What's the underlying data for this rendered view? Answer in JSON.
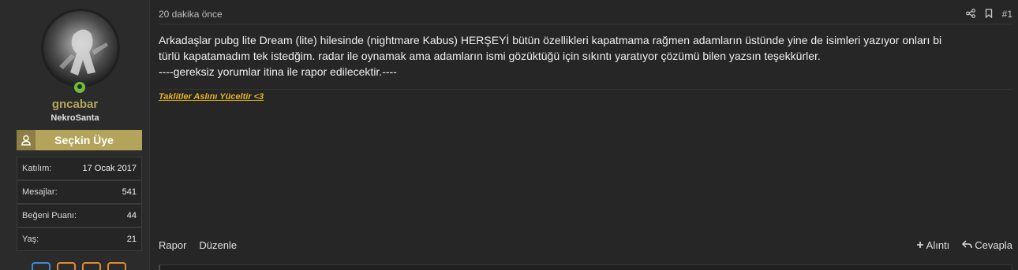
{
  "user": {
    "name": "gncabar",
    "title": "NekroSanta",
    "banner": "Seçkin Üye",
    "stats": [
      {
        "label": "Katılım:",
        "value": "17 Ocak 2017"
      },
      {
        "label": "Mesajlar:",
        "value": "541"
      },
      {
        "label": "Beğeni Puanı:",
        "value": "44"
      },
      {
        "label": "Yaş:",
        "value": "21"
      }
    ],
    "online_color": "#6cbf3c",
    "name_color": "#b5a55e"
  },
  "post": {
    "time": "20 dakika önce",
    "number": "#1",
    "body_line1": "Arkadaşlar pubg lite Dream (lite) hilesinde (nightmare Kabus) HERŞEYİ bütün özellikleri kapatmama rağmen adamların üstünde yine de isimleri yazıyor onları bi",
    "body_line2": "türlü kapatamadım tek istedğim. radar ile oynamak ama adamların ismi gözüktüğü için sıkıntı yaratıyor çözümü bilen yazsın teşekkürler.",
    "body_line3": "----gereksiz yorumlar itina ile rapor edilecektir.----",
    "signature": "Taklitler Aslını Yüceltir <3",
    "signature_color": "#e6b422"
  },
  "footer": {
    "report": "Rapor",
    "edit": "Düzenle",
    "quote": "Alıntı",
    "reply": "Cevapla"
  },
  "icons": [
    "user-icon",
    "share-icon",
    "bookmark-icon",
    "plus-icon",
    "reply-icon"
  ]
}
